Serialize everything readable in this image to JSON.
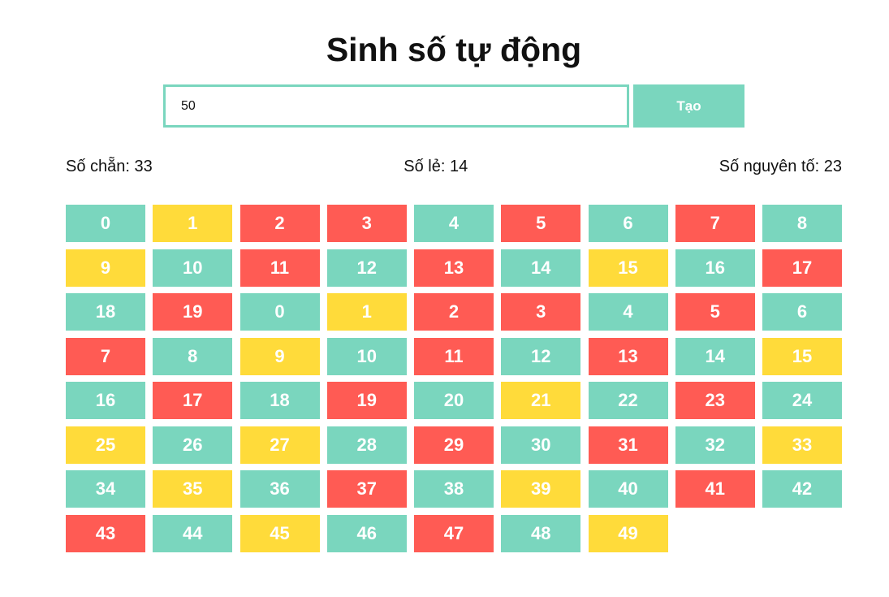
{
  "title": "Sinh số tự động",
  "input": {
    "value": "50"
  },
  "button": {
    "label": "Tạo"
  },
  "stats": {
    "even": "Số chẵn: 33",
    "odd": "Số lẻ: 14",
    "prime": "Số nguyên tố: 23"
  },
  "colors": {
    "even": "#7ad6be",
    "odd": "#ffdb3a",
    "prime": "#ff5b54"
  },
  "numbers": [
    {
      "label": "0",
      "kind": "even"
    },
    {
      "label": "1",
      "kind": "odd"
    },
    {
      "label": "2",
      "kind": "prime"
    },
    {
      "label": "3",
      "kind": "prime"
    },
    {
      "label": "4",
      "kind": "even"
    },
    {
      "label": "5",
      "kind": "prime"
    },
    {
      "label": "6",
      "kind": "even"
    },
    {
      "label": "7",
      "kind": "prime"
    },
    {
      "label": "8",
      "kind": "even"
    },
    {
      "label": "9",
      "kind": "odd"
    },
    {
      "label": "10",
      "kind": "even"
    },
    {
      "label": "11",
      "kind": "prime"
    },
    {
      "label": "12",
      "kind": "even"
    },
    {
      "label": "13",
      "kind": "prime"
    },
    {
      "label": "14",
      "kind": "even"
    },
    {
      "label": "15",
      "kind": "odd"
    },
    {
      "label": "16",
      "kind": "even"
    },
    {
      "label": "17",
      "kind": "prime"
    },
    {
      "label": "18",
      "kind": "even"
    },
    {
      "label": "19",
      "kind": "prime"
    },
    {
      "label": "0",
      "kind": "even"
    },
    {
      "label": "1",
      "kind": "odd"
    },
    {
      "label": "2",
      "kind": "prime"
    },
    {
      "label": "3",
      "kind": "prime"
    },
    {
      "label": "4",
      "kind": "even"
    },
    {
      "label": "5",
      "kind": "prime"
    },
    {
      "label": "6",
      "kind": "even"
    },
    {
      "label": "7",
      "kind": "prime"
    },
    {
      "label": "8",
      "kind": "even"
    },
    {
      "label": "9",
      "kind": "odd"
    },
    {
      "label": "10",
      "kind": "even"
    },
    {
      "label": "11",
      "kind": "prime"
    },
    {
      "label": "12",
      "kind": "even"
    },
    {
      "label": "13",
      "kind": "prime"
    },
    {
      "label": "14",
      "kind": "even"
    },
    {
      "label": "15",
      "kind": "odd"
    },
    {
      "label": "16",
      "kind": "even"
    },
    {
      "label": "17",
      "kind": "prime"
    },
    {
      "label": "18",
      "kind": "even"
    },
    {
      "label": "19",
      "kind": "prime"
    },
    {
      "label": "20",
      "kind": "even"
    },
    {
      "label": "21",
      "kind": "odd"
    },
    {
      "label": "22",
      "kind": "even"
    },
    {
      "label": "23",
      "kind": "prime"
    },
    {
      "label": "24",
      "kind": "even"
    },
    {
      "label": "25",
      "kind": "odd"
    },
    {
      "label": "26",
      "kind": "even"
    },
    {
      "label": "27",
      "kind": "odd"
    },
    {
      "label": "28",
      "kind": "even"
    },
    {
      "label": "29",
      "kind": "prime"
    },
    {
      "label": "30",
      "kind": "even"
    },
    {
      "label": "31",
      "kind": "prime"
    },
    {
      "label": "32",
      "kind": "even"
    },
    {
      "label": "33",
      "kind": "odd"
    },
    {
      "label": "34",
      "kind": "even"
    },
    {
      "label": "35",
      "kind": "odd"
    },
    {
      "label": "36",
      "kind": "even"
    },
    {
      "label": "37",
      "kind": "prime"
    },
    {
      "label": "38",
      "kind": "even"
    },
    {
      "label": "39",
      "kind": "odd"
    },
    {
      "label": "40",
      "kind": "even"
    },
    {
      "label": "41",
      "kind": "prime"
    },
    {
      "label": "42",
      "kind": "even"
    },
    {
      "label": "43",
      "kind": "prime"
    },
    {
      "label": "44",
      "kind": "even"
    },
    {
      "label": "45",
      "kind": "odd"
    },
    {
      "label": "46",
      "kind": "even"
    },
    {
      "label": "47",
      "kind": "prime"
    },
    {
      "label": "48",
      "kind": "even"
    },
    {
      "label": "49",
      "kind": "odd"
    }
  ]
}
